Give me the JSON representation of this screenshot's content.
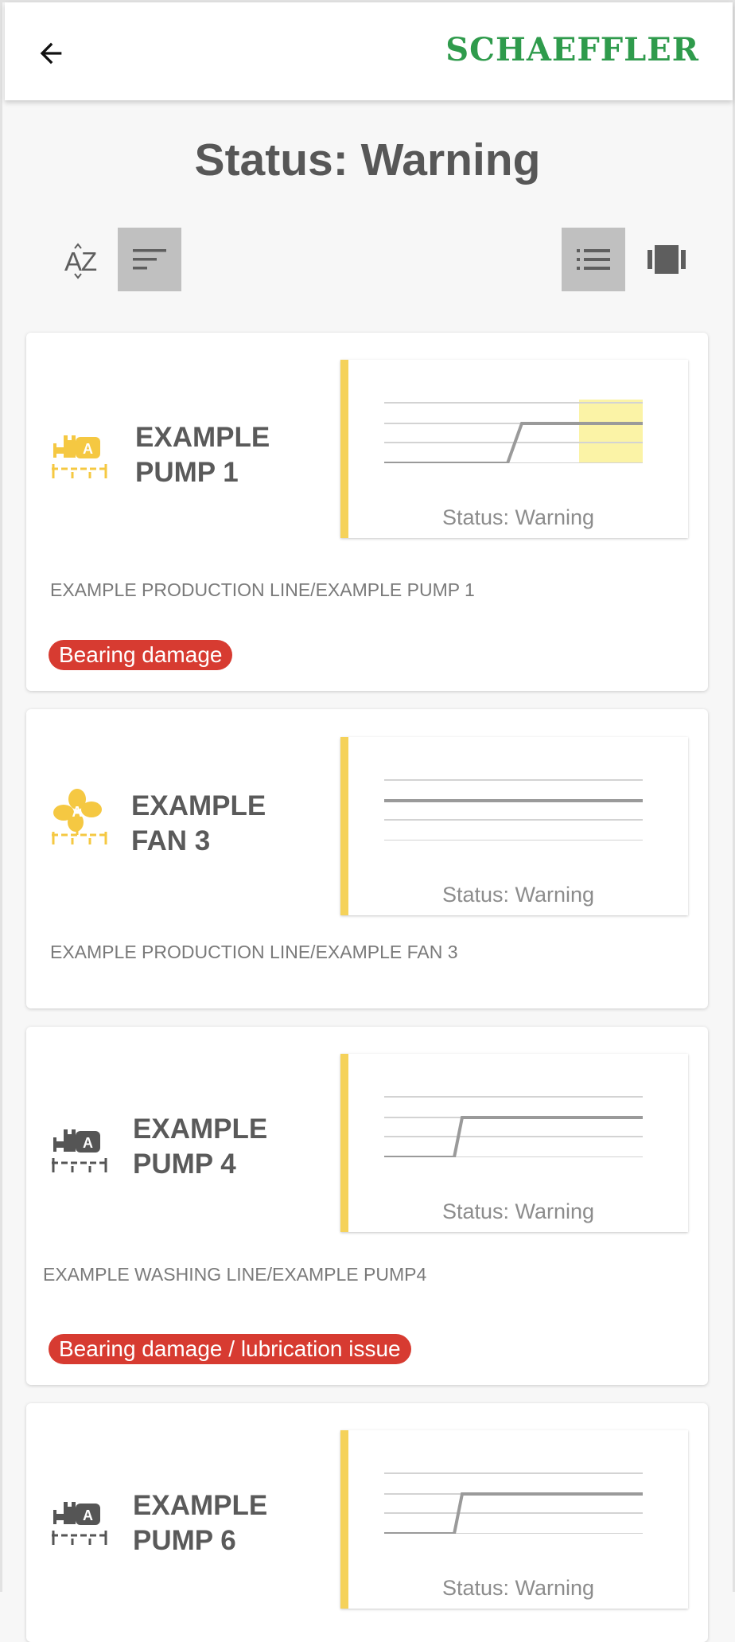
{
  "header": {
    "logo": "SCHAEFFLER"
  },
  "page": {
    "title": "Status: Warning"
  },
  "colors": {
    "brand_green": "#2f9b4c",
    "warning_yellow": "#f5d25a",
    "issue_red": "#d73b31",
    "active_toggle_gray": "#c0c0c0"
  },
  "toolbar": {
    "sort_alpha_icon": "sort-alphabetical-icon",
    "sort_status_icon": "sort-lines-icon",
    "list_view_icon": "list-view-icon",
    "card_view_icon": "card-carousel-icon"
  },
  "assets": [
    {
      "name": "EXAMPLE PUMP 1",
      "type": "pump",
      "path": "EXAMPLE PRODUCTION LINE/EXAMPLE PUMP 1",
      "status": "Status: Warning",
      "issue": "Bearing damage"
    },
    {
      "name": "EXAMPLE FAN 3",
      "type": "fan",
      "path": "EXAMPLE PRODUCTION LINE/EXAMPLE FAN 3",
      "status": "Status: Warning",
      "issue": ""
    },
    {
      "name": "EXAMPLE PUMP 4",
      "type": "pump",
      "path": "EXAMPLE  WASHING LINE/EXAMPLE PUMP4",
      "status": "Status: Warning",
      "issue": "Bearing damage / lubrication issue"
    },
    {
      "name": "EXAMPLE PUMP 6",
      "type": "pump",
      "path": "",
      "status": "Status: Warning",
      "issue": ""
    }
  ]
}
